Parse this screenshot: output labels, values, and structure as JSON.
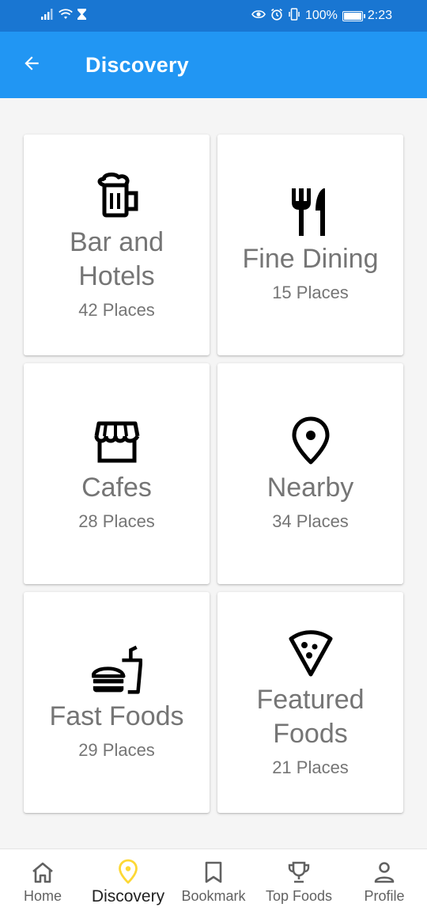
{
  "status_bar": {
    "battery": "100%",
    "time": "2:23"
  },
  "app_bar": {
    "title": "Discovery"
  },
  "categories": [
    {
      "title": "Bar and Hotels",
      "count": "42 Places",
      "icon": "beer-mug-icon"
    },
    {
      "title": "Fine Dining",
      "count": "15 Places",
      "icon": "fork-knife-icon"
    },
    {
      "title": "Cafes",
      "count": "28 Places",
      "icon": "storefront-icon"
    },
    {
      "title": "Nearby",
      "count": "34 Places",
      "icon": "location-pin-icon"
    },
    {
      "title": "Fast Foods",
      "count": "29 Places",
      "icon": "fastfood-icon"
    },
    {
      "title": "Featured Foods",
      "count": "21 Places",
      "icon": "pizza-slice-icon"
    }
  ],
  "bottom_nav": {
    "items": [
      {
        "label": "Home",
        "icon": "home-icon"
      },
      {
        "label": "Discovery",
        "icon": "location-pin-icon",
        "active": true,
        "active_color": "#fdd835"
      },
      {
        "label": "Bookmark",
        "icon": "bookmark-icon"
      },
      {
        "label": "Top Foods",
        "icon": "trophy-icon"
      },
      {
        "label": "Profile",
        "icon": "person-icon"
      }
    ]
  },
  "colors": {
    "status_bar": "#1976d2",
    "app_bar": "#2196f3",
    "background": "#f5f5f5",
    "text_muted": "#757575"
  }
}
